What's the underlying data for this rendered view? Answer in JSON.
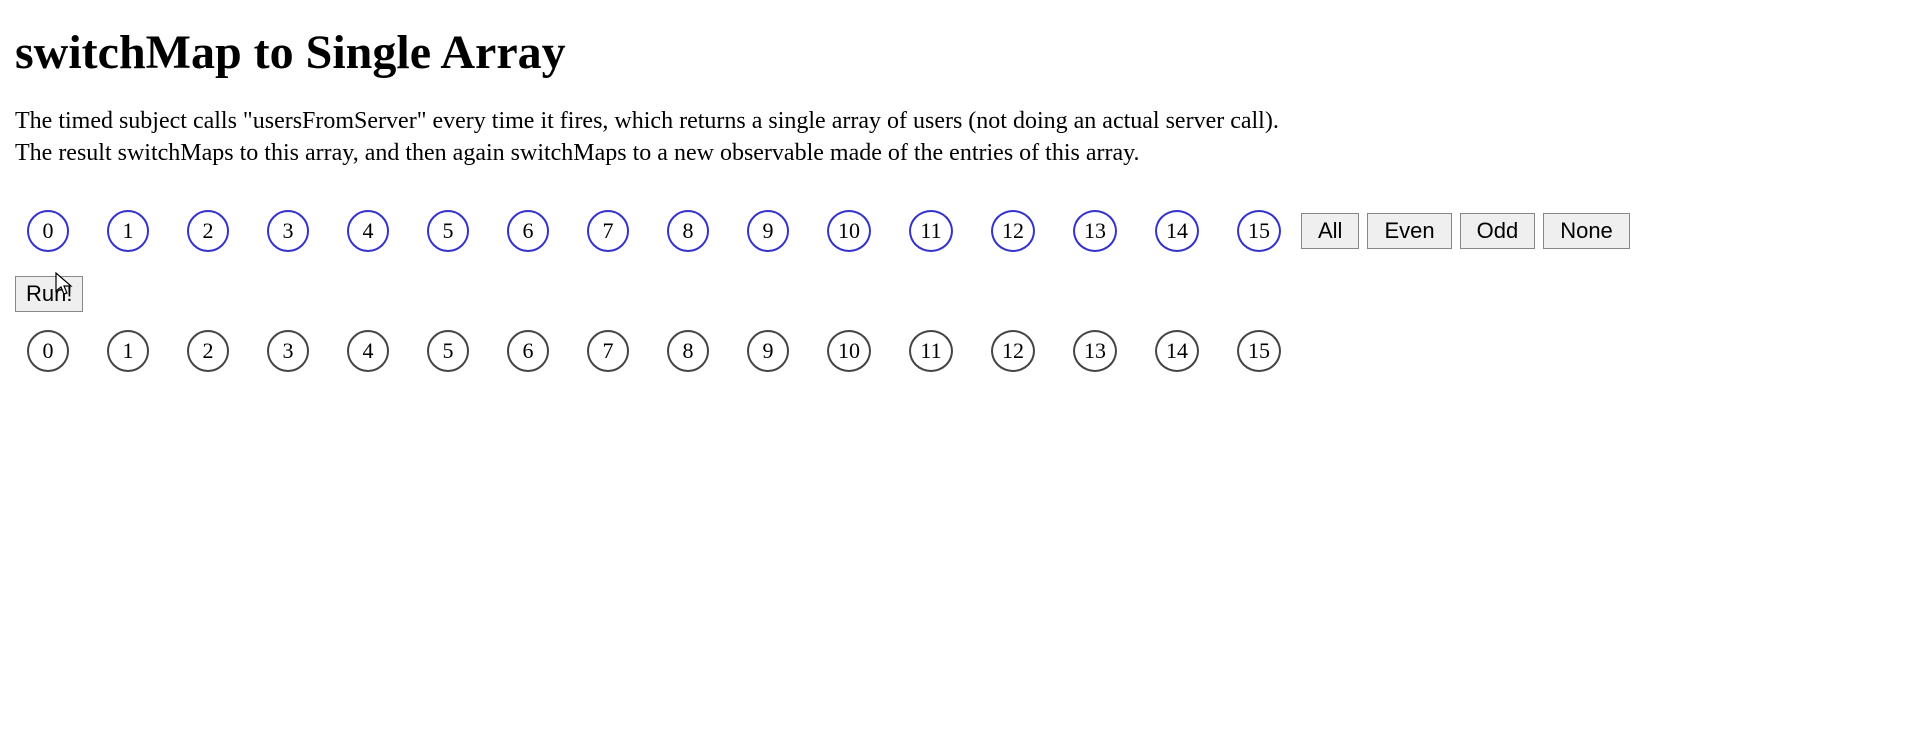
{
  "heading": "switchMap to Single Array",
  "description": "The timed subject calls \"usersFromServer\" every time it fires, which returns a single array of users (not doing an actual server call). The result switchMaps to this array, and then again switchMaps to a new observable made of the entries of this array.",
  "top_row_items": [
    "0",
    "1",
    "2",
    "3",
    "4",
    "5",
    "6",
    "7",
    "8",
    "9",
    "10",
    "11",
    "12",
    "13",
    "14",
    "15"
  ],
  "bottom_row_items": [
    "0",
    "1",
    "2",
    "3",
    "4",
    "5",
    "6",
    "7",
    "8",
    "9",
    "10",
    "11",
    "12",
    "13",
    "14",
    "15"
  ],
  "buttons": {
    "all": "All",
    "even": "Even",
    "odd": "Odd",
    "none": "None",
    "run": "Run!"
  },
  "colors": {
    "top_circle_border": "#3333cc",
    "bottom_circle_border": "#444444",
    "button_bg": "#efefef"
  }
}
